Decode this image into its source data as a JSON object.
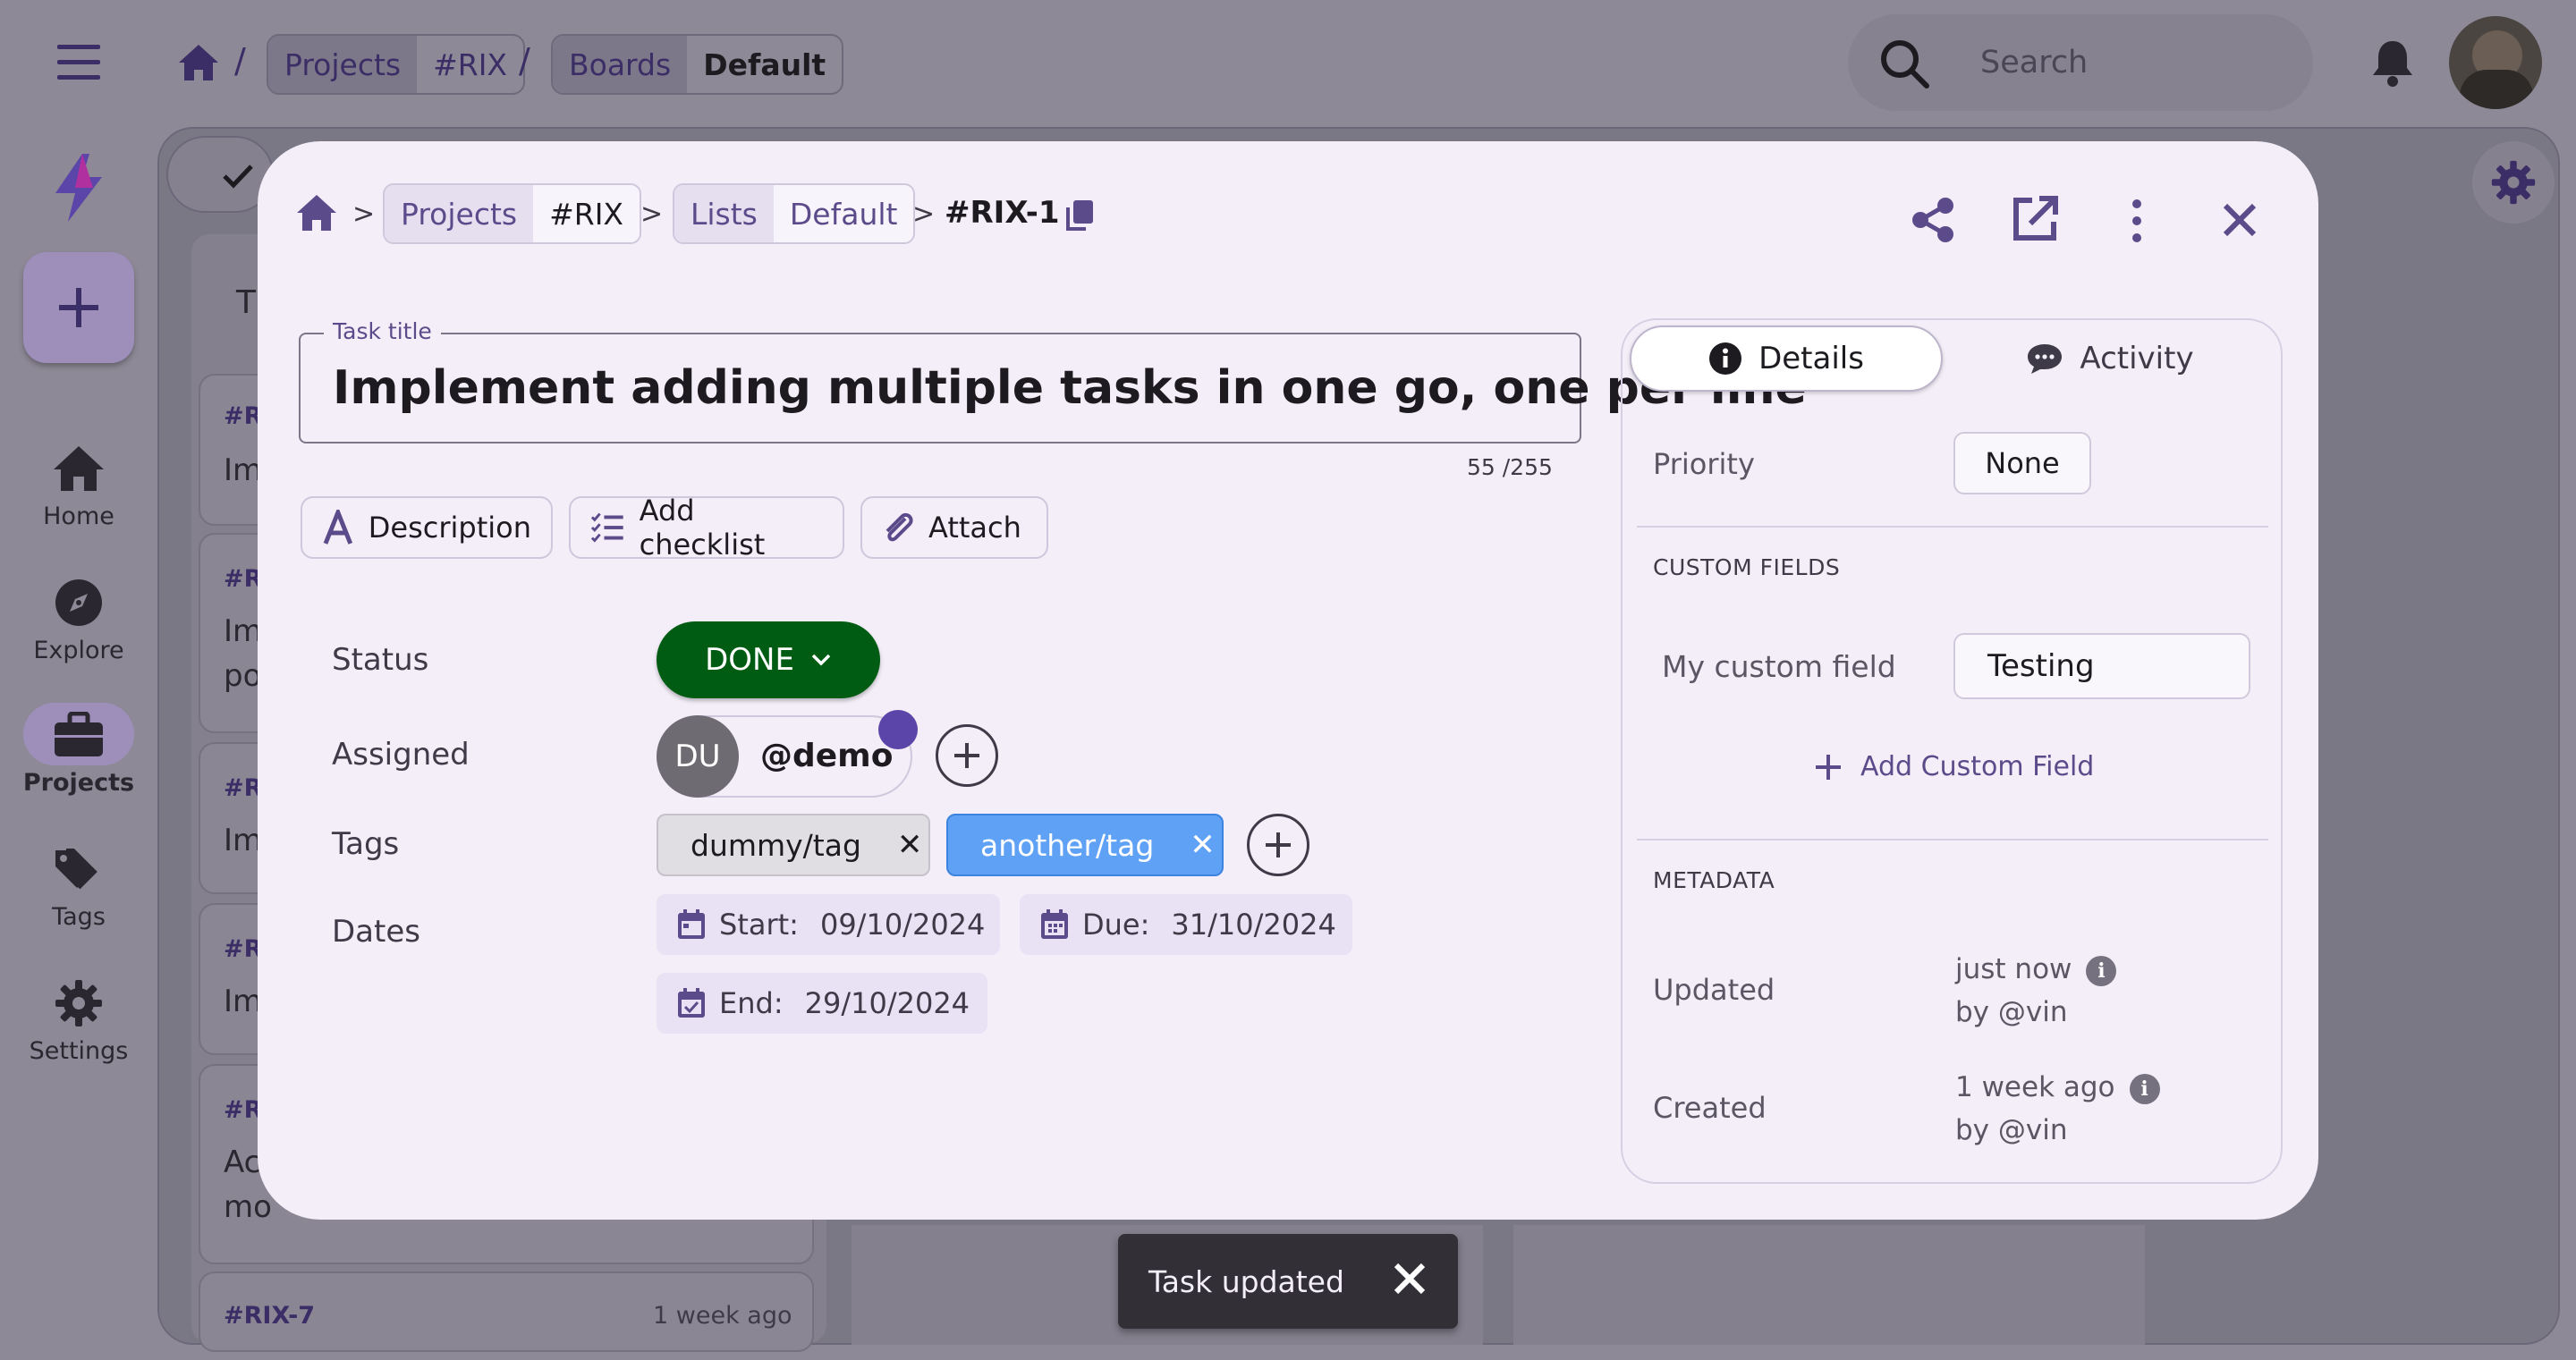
{
  "topbar": {
    "breadcrumb": [
      "Projects",
      "#RIX",
      "Boards",
      "Default"
    ],
    "search_placeholder": "Search"
  },
  "sidebar": {
    "items": [
      {
        "label": "Home",
        "icon": "home-icon"
      },
      {
        "label": "Explore",
        "icon": "compass-icon"
      },
      {
        "label": "Projects",
        "icon": "briefcase-icon"
      },
      {
        "label": "Tags",
        "icon": "tag-icon"
      },
      {
        "label": "Settings",
        "icon": "gear-icon"
      }
    ]
  },
  "background": {
    "column_header_fragment": "T",
    "cards": [
      {
        "id": "#R",
        "text": "Im"
      },
      {
        "id": "#R",
        "text": "Im",
        "text2": "po"
      },
      {
        "id": "#R",
        "text": "Im"
      },
      {
        "id": "#R",
        "text": "Im"
      },
      {
        "id": "#R",
        "text": "Ac",
        "text2": "mo"
      },
      {
        "id": "#RIX-7",
        "time": "1 week ago"
      }
    ]
  },
  "modal": {
    "breadcrumb": {
      "projects": "Projects",
      "project_id": "#RIX",
      "lists": "Lists",
      "list_name": "Default",
      "task_id": "#RIX-1",
      "separator": ">"
    },
    "title_label": "Task title",
    "title": "Implement adding multiple tasks in one go, one per line",
    "title_counter": "55 /255",
    "actions": {
      "description": "Description",
      "checklist": "Add checklist",
      "attach": "Attach"
    },
    "fields": {
      "status_label": "Status",
      "status_value": "DONE",
      "assigned_label": "Assigned",
      "assignee_initials": "DU",
      "assignee_name": "@demo",
      "tags_label": "Tags",
      "tags": [
        "dummy/tag",
        "another/tag"
      ],
      "dates_label": "Dates",
      "start_label": "Start:",
      "start_value": "09/10/2024",
      "due_label": "Due:",
      "due_value": "31/10/2024",
      "end_label": "End:",
      "end_value": "29/10/2024"
    },
    "panel": {
      "tab_details": "Details",
      "tab_activity": "Activity",
      "priority_label": "Priority",
      "priority_value": "None",
      "custom_fields_heading": "CUSTOM FIELDS",
      "custom_field_name": "My custom field",
      "custom_field_value": "Testing",
      "add_custom_field": "Add Custom Field",
      "metadata_heading": "METADATA",
      "updated_label": "Updated",
      "updated_when": "just now",
      "updated_by": "by @vin",
      "created_label": "Created",
      "created_when": "1 week ago",
      "created_by": "by @vin"
    }
  },
  "toast": {
    "message": "Task updated"
  },
  "colors": {
    "accent": "#5c4b8a",
    "status_done": "#005c12",
    "tag_active": "#5fa1f5",
    "modal_bg": "#f3eef8"
  }
}
